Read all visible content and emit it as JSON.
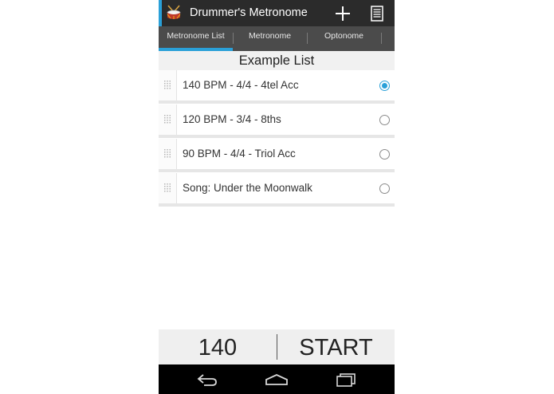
{
  "app": {
    "title": "Drummer's Metronome",
    "icon": "drum-icon"
  },
  "actions": [
    {
      "name": "add-icon"
    },
    {
      "name": "list-icon"
    }
  ],
  "tabs": [
    {
      "label": "Metronome List",
      "selected": true
    },
    {
      "label": "Metronome",
      "selected": false
    },
    {
      "label": "Optonome",
      "selected": false
    }
  ],
  "list": {
    "header": "Example List",
    "items": [
      {
        "label": "140 BPM - 4/4 - 4tel Acc",
        "selected": true
      },
      {
        "label": "120 BPM - 3/4 - 8ths",
        "selected": false
      },
      {
        "label": "90 BPM - 4/4 - Triol Acc",
        "selected": false
      },
      {
        "label": "Song: Under the Moonwalk",
        "selected": false
      }
    ]
  },
  "controls": {
    "bpm": "140",
    "start_label": "START"
  },
  "navbar": [
    "back-icon",
    "home-icon",
    "recent-apps-icon"
  ],
  "colors": {
    "accent": "#2aa0d8",
    "actionbar": "#2b2b2b",
    "tabbar": "#4b4b4b"
  }
}
